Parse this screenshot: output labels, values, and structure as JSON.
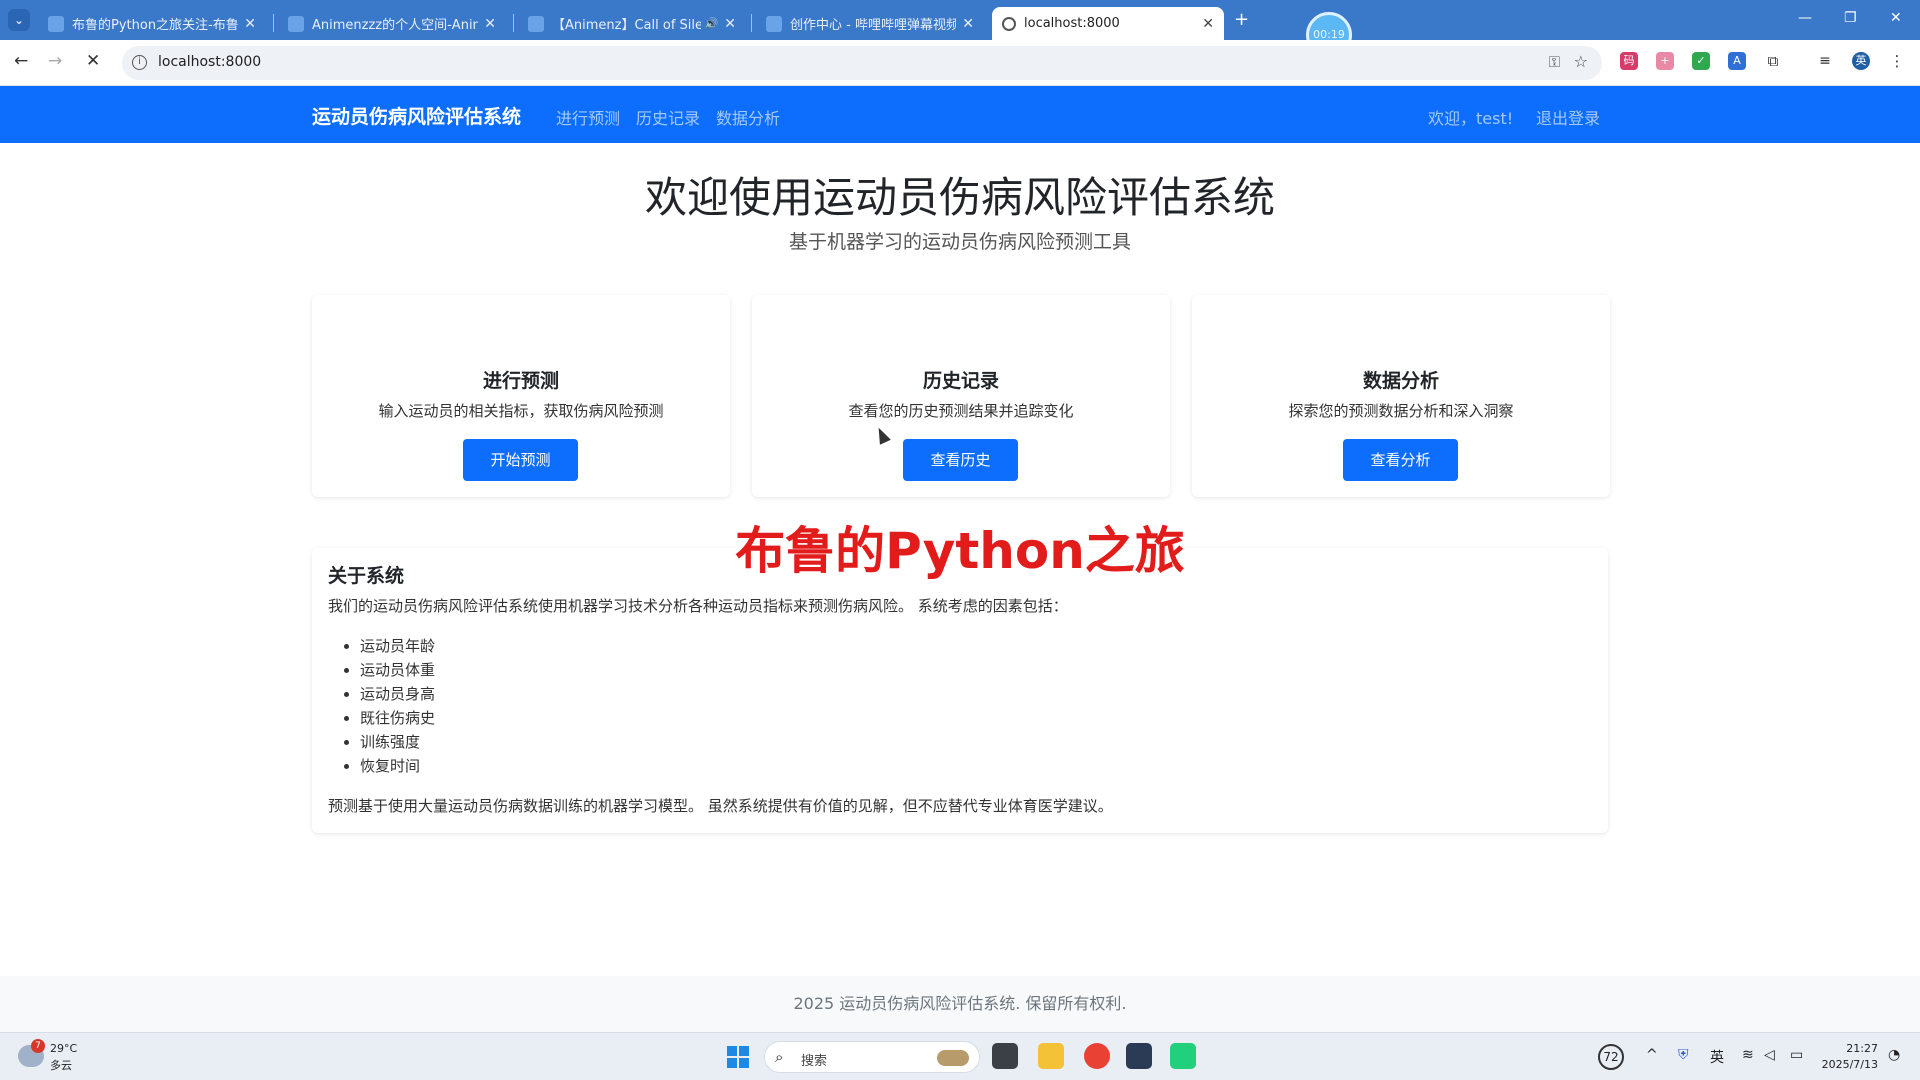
{
  "browser": {
    "tabs": [
      {
        "title": "布鲁的Python之旅关注-布鲁的"
      },
      {
        "title": "Animenzzz的个人空间-Anime"
      },
      {
        "title": "【Animenz】Call of Silen"
      },
      {
        "title": "创作中心 - 哔哩哔哩弹幕视频"
      },
      {
        "title": "localhost:8000"
      }
    ],
    "recording_time": "00:19",
    "url": "localhost:8000"
  },
  "navbar": {
    "brand": "运动员伤病风险评估系统",
    "links": [
      "进行预测",
      "历史记录",
      "数据分析"
    ],
    "welcome": "欢迎，test!",
    "logout": "退出登录"
  },
  "hero": {
    "title": "欢迎使用运动员伤病风险评估系统",
    "subtitle": "基于机器学习的运动员伤病风险预测工具"
  },
  "cards": [
    {
      "title": "进行预测",
      "desc": "输入运动员的相关指标，获取伤病风险预测",
      "button": "开始预测"
    },
    {
      "title": "历史记录",
      "desc": "查看您的历史预测结果并追踪变化",
      "button": "查看历史"
    },
    {
      "title": "数据分析",
      "desc": "探索您的预测数据分析和深入洞察",
      "button": "查看分析"
    }
  ],
  "watermark": "布鲁的Python之旅",
  "about": {
    "title": "关于系统",
    "intro": "我们的运动员伤病风险评估系统使用机器学习技术分析各种运动员指标来预测伤病风险。 系统考虑的因素包括：",
    "factors": [
      "运动员年龄",
      "运动员体重",
      "运动员身高",
      "既往伤病史",
      "训练强度",
      "恢复时间"
    ],
    "outro": "预测基于使用大量运动员伤病数据训练的机器学习模型。 虽然系统提供有价值的见解，但不应替代专业体育医学建议。"
  },
  "footer": "2025 运动员伤病风险评估系统. 保留所有权利.",
  "taskbar": {
    "weather_badge": "7",
    "weather_temp": "29°C",
    "weather_desc": "多云",
    "search_label": "搜索",
    "tray_number": "72",
    "ime": "英",
    "time": "21:27",
    "date": "2025/7/13"
  }
}
